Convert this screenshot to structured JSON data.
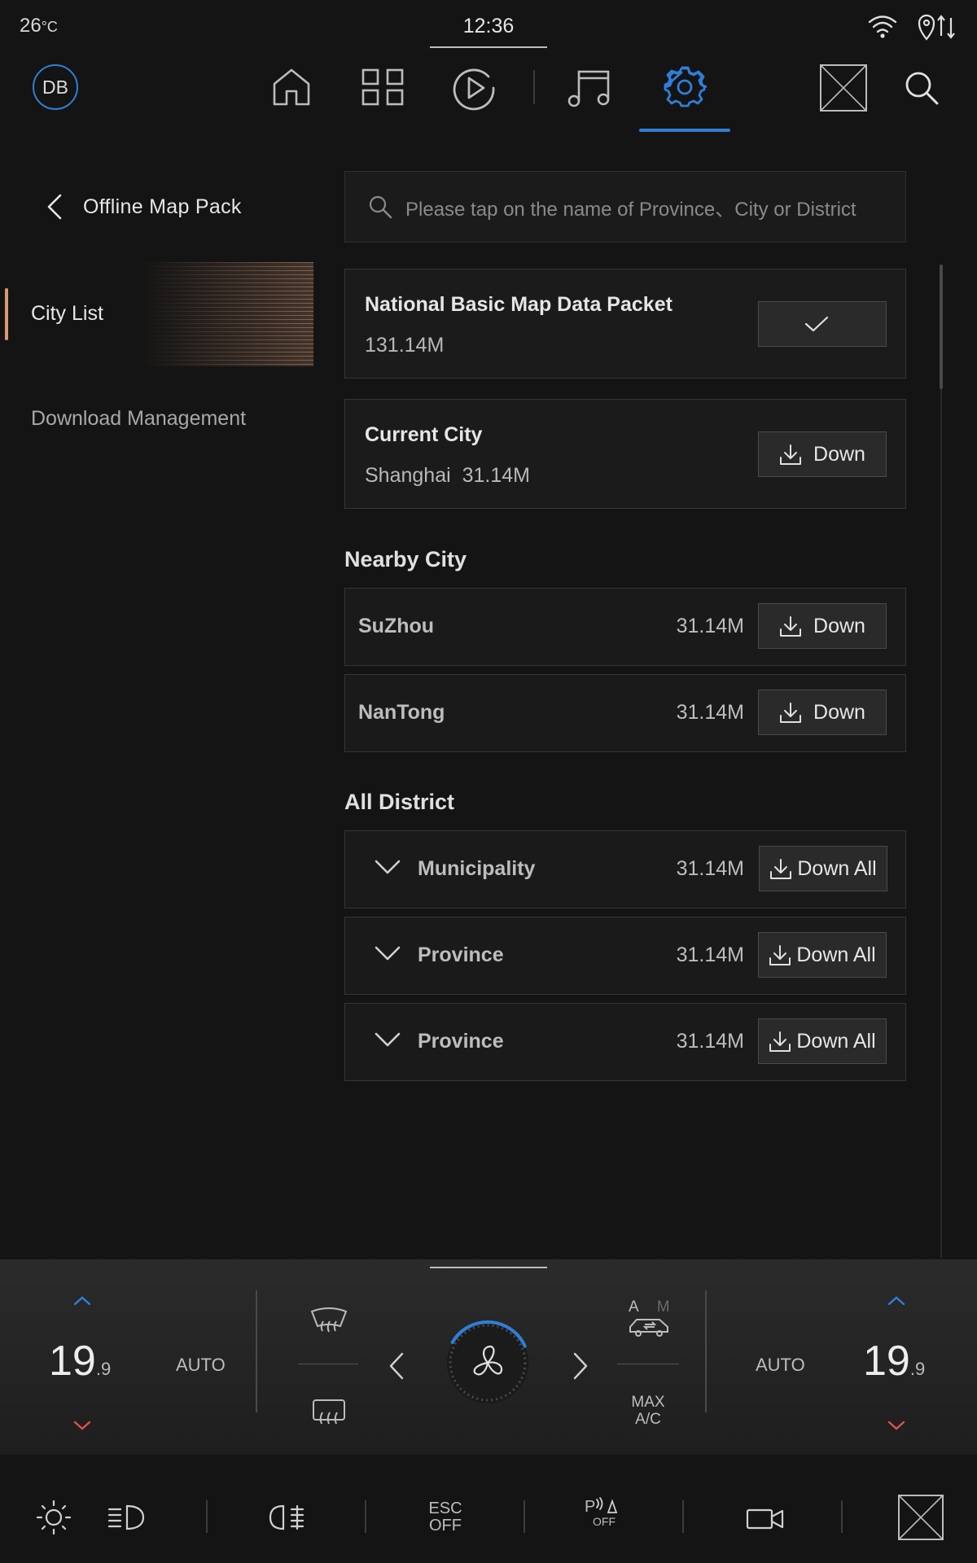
{
  "status_bar": {
    "temperature": "26",
    "temperature_unit": "°C",
    "time": "12:36"
  },
  "nav": {
    "avatar_initials": "DB",
    "items": [
      {
        "name": "home",
        "icon": "home-icon"
      },
      {
        "name": "apps",
        "icon": "grid-icon"
      },
      {
        "name": "media",
        "icon": "play-icon"
      },
      {
        "name": "music",
        "icon": "music-icon"
      },
      {
        "name": "settings",
        "icon": "gear-icon",
        "active": true
      }
    ],
    "accent_color": "#2f7fd9"
  },
  "sidebar": {
    "back_title": "Offline Map Pack",
    "items": [
      {
        "label": "City List",
        "active": true
      },
      {
        "label": "Download Management",
        "active": false
      }
    ]
  },
  "search": {
    "placeholder": "Please tap on the name of Province、City or District"
  },
  "national": {
    "title": "National Basic Map Data Packet",
    "size": "131.14M",
    "status": "downloaded"
  },
  "current_city": {
    "title": "Current City",
    "city": "Shanghai",
    "size": "31.14M",
    "button": "Down"
  },
  "nearby": {
    "title": "Nearby City",
    "items": [
      {
        "name": "SuZhou",
        "size": "31.14M",
        "button": "Down"
      },
      {
        "name": "NanTong",
        "size": "31.14M",
        "button": "Down"
      }
    ]
  },
  "districts": {
    "title": "All District",
    "items": [
      {
        "name": "Municipality",
        "size": "31.14M",
        "button": "Down All"
      },
      {
        "name": "Province",
        "size": "31.14M",
        "button": "Down All"
      },
      {
        "name": "Province",
        "size": "31.14M",
        "button": "Down All"
      }
    ]
  },
  "climate": {
    "left_temp": "19",
    "left_temp_decimal": ".9",
    "right_temp": "19",
    "right_temp_decimal": ".9",
    "left_mode": "AUTO",
    "right_mode": "AUTO",
    "circ_a": "A",
    "circ_m": "M",
    "max_ac_line1": "MAX",
    "max_ac_line2": "A/C",
    "fan_level": 0.35
  },
  "quick_bar": {
    "esc_line1": "ESC",
    "esc_line2": "OFF",
    "park_p": "P",
    "park_off": "OFF"
  }
}
